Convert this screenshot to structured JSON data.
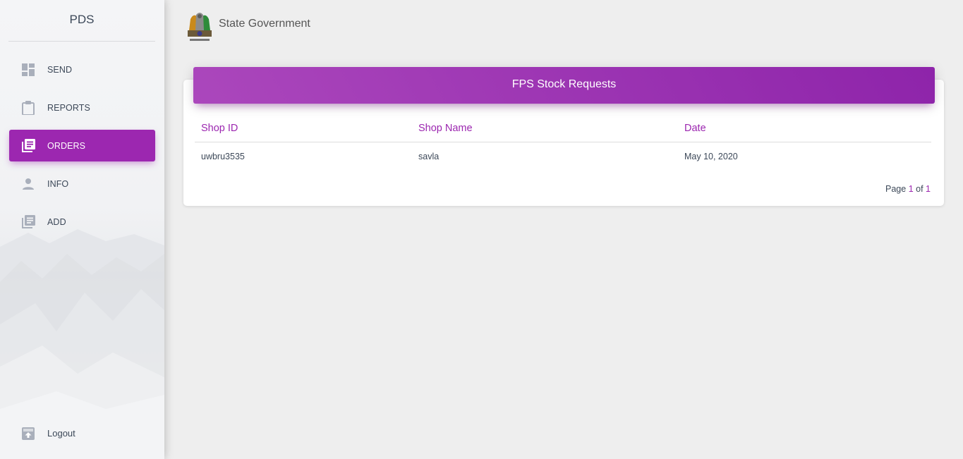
{
  "sidebar": {
    "brand": "PDS",
    "items": [
      {
        "label": "SEND",
        "icon": "dashboard-icon",
        "active": false
      },
      {
        "label": "REPORTS",
        "icon": "clipboard-icon",
        "active": false
      },
      {
        "label": "ORDERS",
        "icon": "library-books-icon",
        "active": true
      },
      {
        "label": "INFO",
        "icon": "person-icon",
        "active": false
      },
      {
        "label": "ADD",
        "icon": "library-books-icon",
        "active": false
      }
    ],
    "logout_label": "Logout"
  },
  "header": {
    "title": "State Government",
    "emblem_icon": "national-emblem-icon"
  },
  "card": {
    "title": "FPS Stock Requests",
    "columns": [
      "Shop ID",
      "Shop Name",
      "Date"
    ],
    "rows": [
      {
        "shop_id": "uwbru3535",
        "shop_name": "savla",
        "date": "May 10, 2020"
      }
    ],
    "pager": {
      "prefix": "Page",
      "current": "1",
      "sep": "of",
      "total": "1"
    }
  },
  "colors": {
    "accent": "#9c27b0",
    "background": "#eeeeee",
    "text": "#3c4858"
  }
}
